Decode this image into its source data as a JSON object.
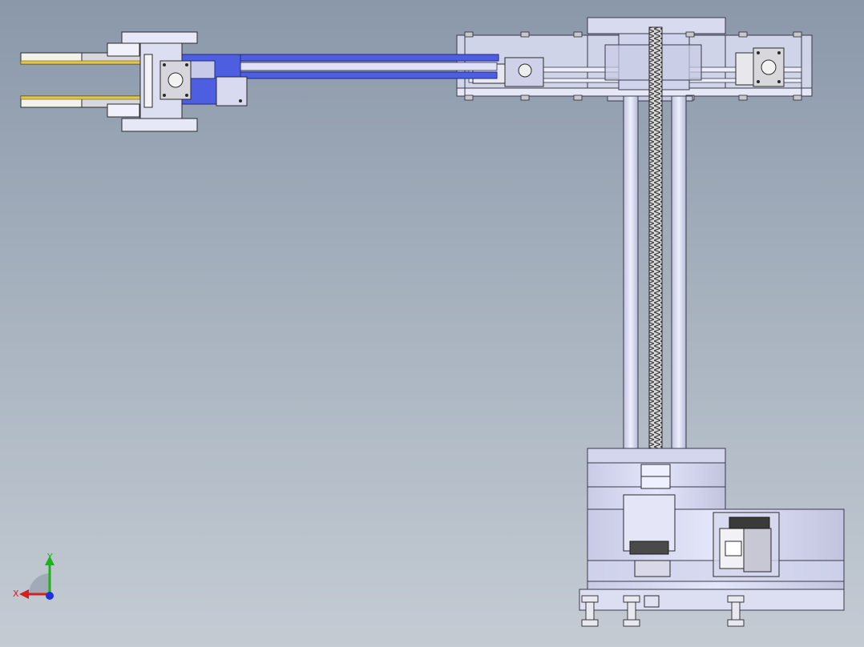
{
  "viewport": {
    "background_top": "#8a98aa",
    "background_bottom": "#c4cbd3"
  },
  "model": {
    "colors": {
      "frame_fill": "#d9dbef",
      "frame_stroke": "#3a3a4a",
      "arm_blue": "#4d5fe0",
      "arm_blue_dark": "#2a37a8",
      "finger_yellow": "#e2c64c",
      "finger_white": "#f2f2ea",
      "leadscrew": "#505050",
      "column": "#cfd2e8"
    }
  },
  "triad": {
    "x_label": "X",
    "y_label": "Y",
    "x_color": "#d42020",
    "y_color": "#1bb51b",
    "z_color": "#2030e0"
  }
}
